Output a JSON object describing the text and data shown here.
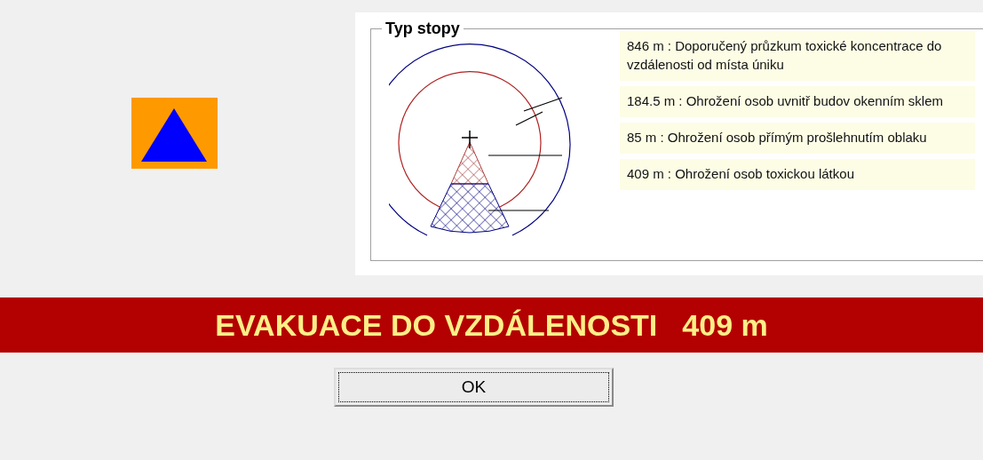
{
  "group": {
    "title": "Typ stopy",
    "zones": [
      {
        "label": "846 m : Doporučený průzkum toxické koncentrace do vzdálenosti od místa úniku"
      },
      {
        "label": "184.5 m : Ohrožení osob uvnitř budov okenním sklem"
      },
      {
        "label": "85 m : Ohrožení osob přímým prošlehnutím oblaku"
      },
      {
        "label": "409 m : Ohrožení osob toxickou látkou"
      }
    ]
  },
  "banner": {
    "title": "EVAKUACE DO VZDÁLENOSTI",
    "distance": "409 m"
  },
  "buttons": [
    {
      "label": "OK"
    }
  ]
}
